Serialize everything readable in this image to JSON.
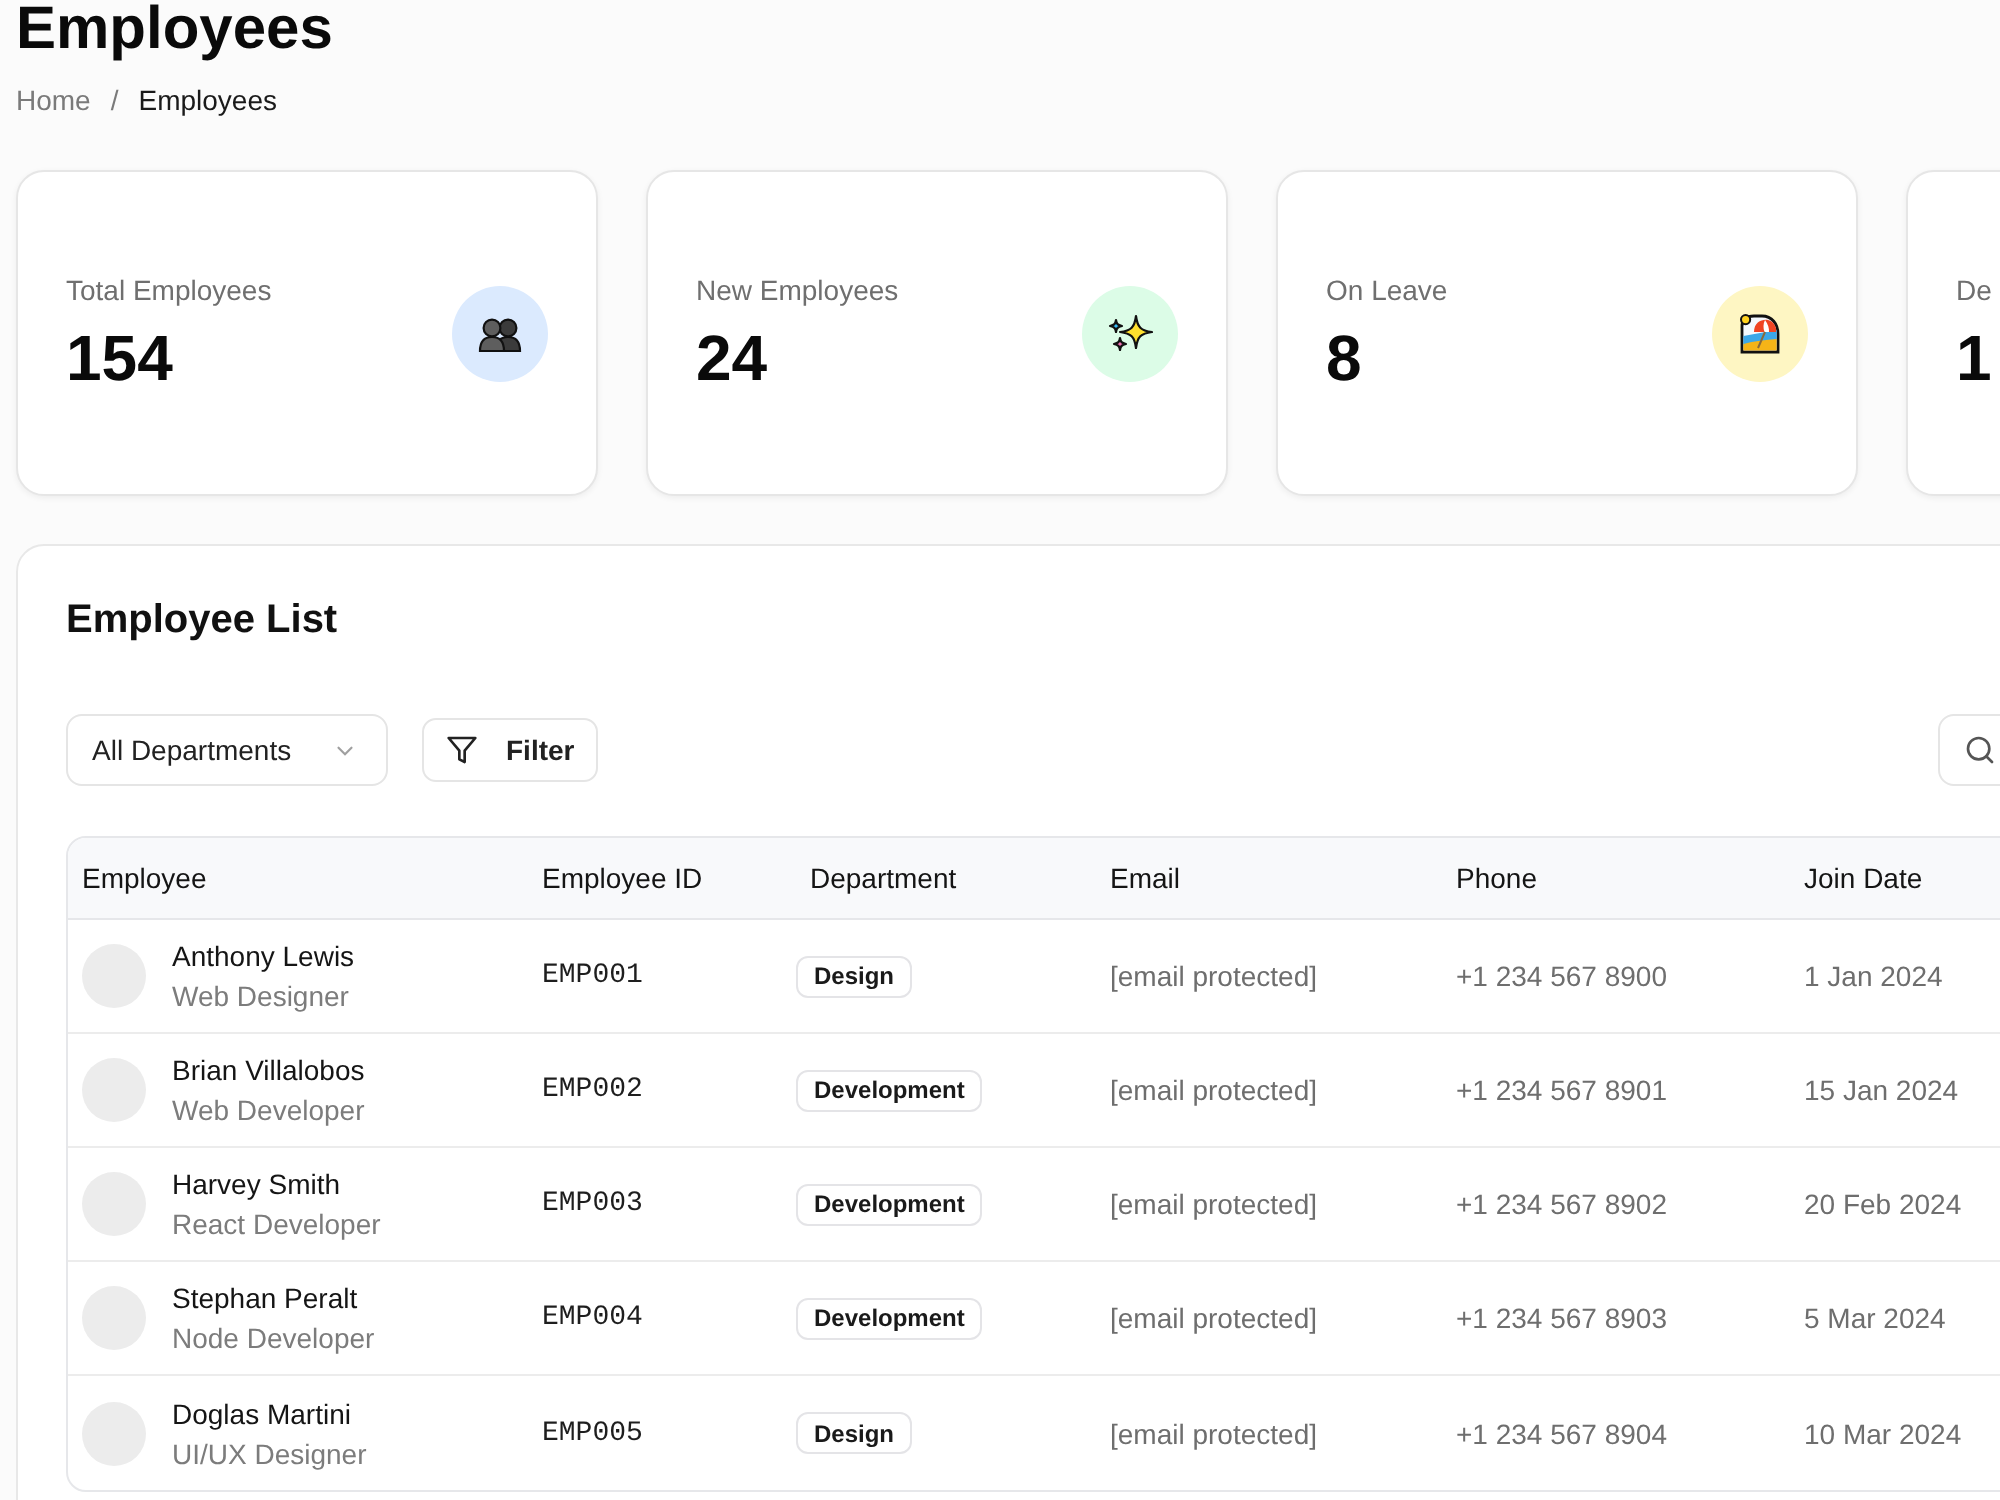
{
  "page": {
    "title": "Employees",
    "breadcrumb": {
      "items": [
        "Home",
        "Employees"
      ],
      "separator": "/"
    }
  },
  "stats": [
    {
      "label": "Total Employees",
      "value": "154"
    },
    {
      "label": "New Employees",
      "value": "24"
    },
    {
      "label": "On Leave",
      "value": "8"
    },
    {
      "label": "De",
      "value": "1"
    }
  ],
  "employee_list": {
    "title": "Employee List",
    "department_filter": {
      "value": "All Departments"
    },
    "filter_button": {
      "label": "Filter"
    },
    "table": {
      "columns": [
        "Employee",
        "Employee ID",
        "Department",
        "Email",
        "Phone",
        "Join Date"
      ],
      "rows": [
        {
          "name": "Anthony Lewis",
          "role": "Web Designer",
          "employee_id": "EMP001",
          "department": "Design",
          "email": "[email protected]",
          "phone": "+1 234 567 8900",
          "join_date": "1 Jan 2024"
        },
        {
          "name": "Brian Villalobos",
          "role": "Web Developer",
          "employee_id": "EMP002",
          "department": "Development",
          "email": "[email protected]",
          "phone": "+1 234 567 8901",
          "join_date": "15 Jan 2024"
        },
        {
          "name": "Harvey Smith",
          "role": "React Developer",
          "employee_id": "EMP003",
          "department": "Development",
          "email": "[email protected]",
          "phone": "+1 234 567 8902",
          "join_date": "20 Feb 2024"
        },
        {
          "name": "Stephan Peralt",
          "role": "Node Developer",
          "employee_id": "EMP004",
          "department": "Development",
          "email": "[email protected]",
          "phone": "+1 234 567 8903",
          "join_date": "5 Mar 2024"
        },
        {
          "name": "Doglas Martini",
          "role": "UI/UX Designer",
          "employee_id": "EMP005",
          "department": "Design",
          "email": "[email protected]",
          "phone": "+1 234 567 8904",
          "join_date": "10 Mar 2024"
        }
      ]
    }
  }
}
